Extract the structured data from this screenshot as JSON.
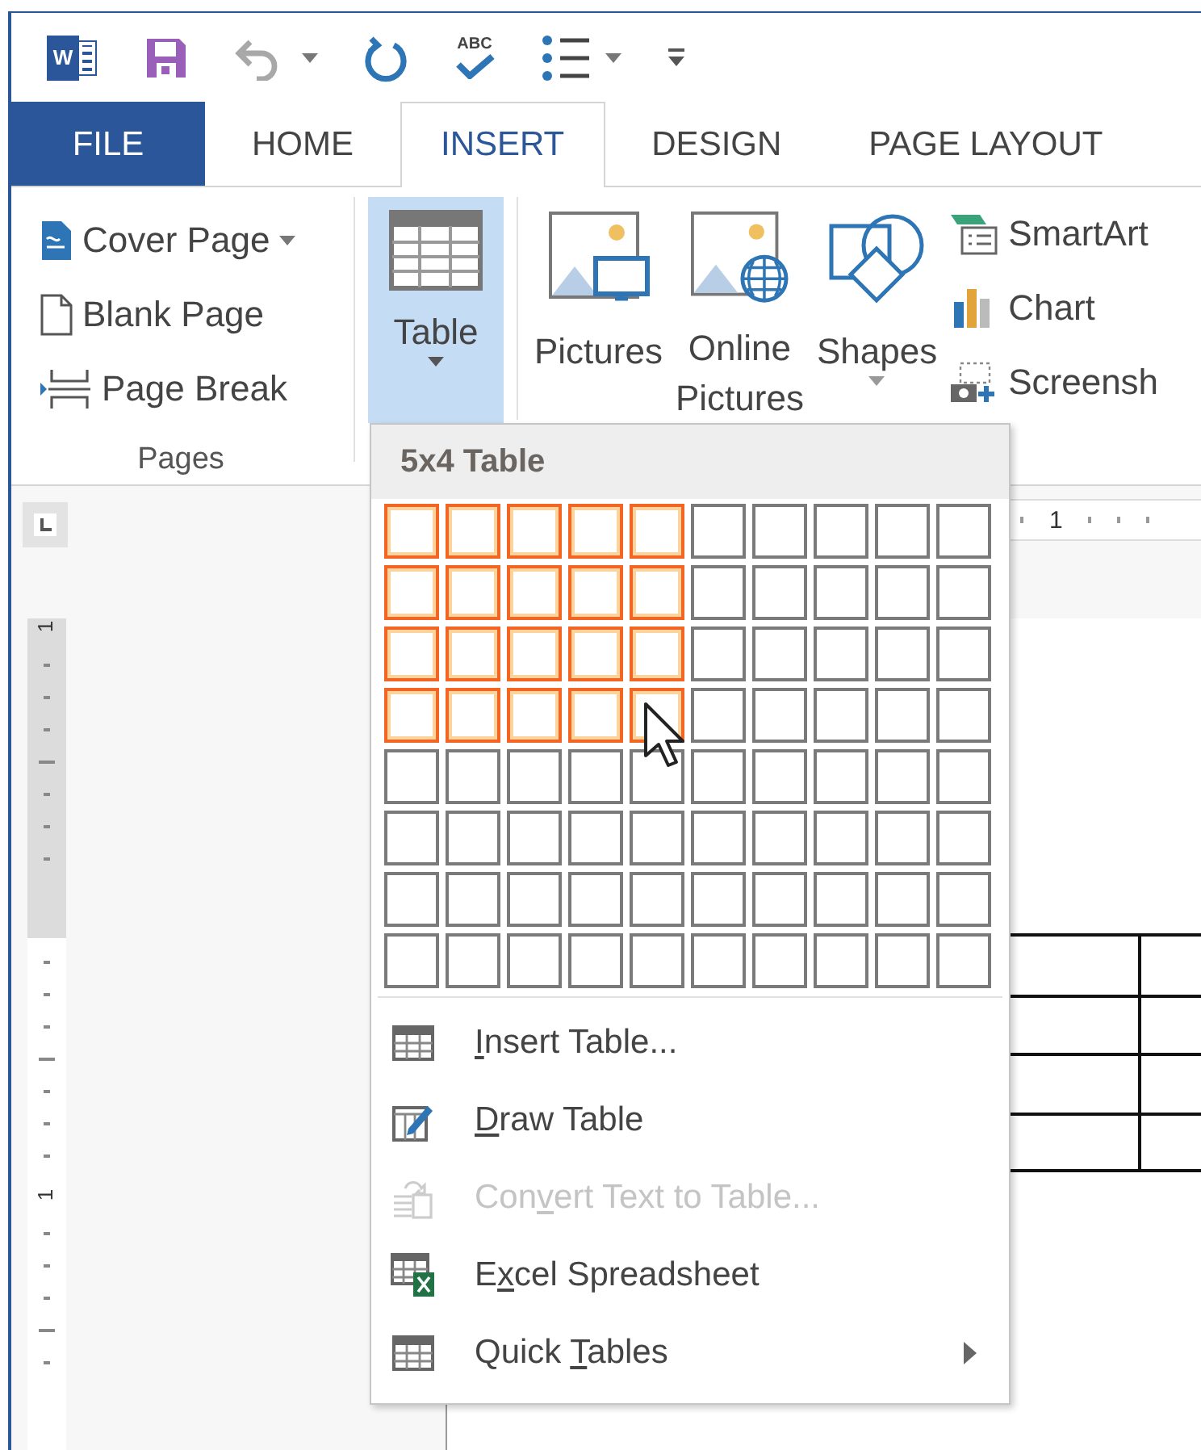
{
  "quick_access": [
    {
      "kind": "word",
      "label": "W"
    },
    {
      "kind": "save"
    },
    {
      "kind": "undo",
      "disabled": true,
      "dropdown": true
    },
    {
      "kind": "repeat"
    },
    {
      "kind": "spelling",
      "label": "ABC"
    },
    {
      "kind": "bullets",
      "dropdown": true
    },
    {
      "kind": "customize"
    }
  ],
  "tabs": [
    {
      "label": "FILE",
      "kind": "file",
      "selected": false
    },
    {
      "label": "HOME",
      "kind": "tab",
      "selected": false
    },
    {
      "label": "INSERT",
      "kind": "tab",
      "selected": true
    },
    {
      "label": "DESIGN",
      "kind": "tab",
      "selected": false
    },
    {
      "label": "PAGE LAYOUT",
      "kind": "tab",
      "selected": false
    }
  ],
  "ribbon": {
    "pages_group": {
      "label": "Pages",
      "items": [
        {
          "kind": "cover",
          "label": "Cover Page",
          "dropdown": true
        },
        {
          "kind": "blank",
          "label": "Blank Page"
        },
        {
          "kind": "break",
          "label": "Page Break"
        }
      ]
    },
    "table_button": {
      "lines": [
        "Table"
      ],
      "dropdown": true,
      "selected": true
    },
    "large_buttons": [
      {
        "kind": "pictures",
        "lines": [
          "Pictures"
        ],
        "selected": false
      },
      {
        "kind": "online",
        "lines": [
          "Online",
          "Pictures"
        ],
        "selected": false
      },
      {
        "kind": "shapes",
        "lines": [
          "Shapes"
        ],
        "dropdown": true,
        "selected": false
      }
    ],
    "small_buttons": [
      {
        "kind": "smartart",
        "label": "SmartArt"
      },
      {
        "kind": "chart",
        "label": "Chart"
      },
      {
        "kind": "screenshot",
        "label": "Screensh"
      }
    ]
  },
  "ruler": {
    "horizontal_labels": [
      "1"
    ],
    "vertical_labels": [
      "1",
      "1"
    ]
  },
  "table_menu": {
    "title": "5x4 Table",
    "grid": [
      {
        "cells": [
          {
            "selected": true
          },
          {
            "selected": true
          },
          {
            "selected": true
          },
          {
            "selected": true
          },
          {
            "selected": true
          },
          {
            "selected": false
          },
          {
            "selected": false
          },
          {
            "selected": false
          },
          {
            "selected": false
          },
          {
            "selected": false
          }
        ]
      },
      {
        "cells": [
          {
            "selected": true
          },
          {
            "selected": true
          },
          {
            "selected": true
          },
          {
            "selected": true
          },
          {
            "selected": true
          },
          {
            "selected": false
          },
          {
            "selected": false
          },
          {
            "selected": false
          },
          {
            "selected": false
          },
          {
            "selected": false
          }
        ]
      },
      {
        "cells": [
          {
            "selected": true
          },
          {
            "selected": true
          },
          {
            "selected": true
          },
          {
            "selected": true
          },
          {
            "selected": true
          },
          {
            "selected": false
          },
          {
            "selected": false
          },
          {
            "selected": false
          },
          {
            "selected": false
          },
          {
            "selected": false
          }
        ]
      },
      {
        "cells": [
          {
            "selected": true
          },
          {
            "selected": true
          },
          {
            "selected": true
          },
          {
            "selected": true
          },
          {
            "selected": true
          },
          {
            "selected": false
          },
          {
            "selected": false
          },
          {
            "selected": false
          },
          {
            "selected": false
          },
          {
            "selected": false
          }
        ]
      },
      {
        "cells": [
          {
            "selected": false
          },
          {
            "selected": false
          },
          {
            "selected": false
          },
          {
            "selected": false
          },
          {
            "selected": false
          },
          {
            "selected": false
          },
          {
            "selected": false
          },
          {
            "selected": false
          },
          {
            "selected": false
          },
          {
            "selected": false
          }
        ]
      },
      {
        "cells": [
          {
            "selected": false
          },
          {
            "selected": false
          },
          {
            "selected": false
          },
          {
            "selected": false
          },
          {
            "selected": false
          },
          {
            "selected": false
          },
          {
            "selected": false
          },
          {
            "selected": false
          },
          {
            "selected": false
          },
          {
            "selected": false
          }
        ]
      },
      {
        "cells": [
          {
            "selected": false
          },
          {
            "selected": false
          },
          {
            "selected": false
          },
          {
            "selected": false
          },
          {
            "selected": false
          },
          {
            "selected": false
          },
          {
            "selected": false
          },
          {
            "selected": false
          },
          {
            "selected": false
          },
          {
            "selected": false
          }
        ]
      },
      {
        "cells": [
          {
            "selected": false
          },
          {
            "selected": false
          },
          {
            "selected": false
          },
          {
            "selected": false
          },
          {
            "selected": false
          },
          {
            "selected": false
          },
          {
            "selected": false
          },
          {
            "selected": false
          },
          {
            "selected": false
          },
          {
            "selected": false
          }
        ]
      }
    ],
    "items": [
      {
        "kind": "insert",
        "key": "I",
        "after": "nsert Table...",
        "disabled": false
      },
      {
        "kind": "draw",
        "key": "D",
        "after": "raw Table",
        "disabled": false
      },
      {
        "kind": "convert",
        "before": "Con",
        "key": "v",
        "after": "ert Text to Table...",
        "disabled": true
      },
      {
        "kind": "excel",
        "before": "E",
        "key": "x",
        "after": "cel Spreadsheet",
        "disabled": false
      },
      {
        "kind": "quick",
        "before": "Quick ",
        "key": "T",
        "after": "ables",
        "disabled": false,
        "submenu": true
      }
    ]
  }
}
